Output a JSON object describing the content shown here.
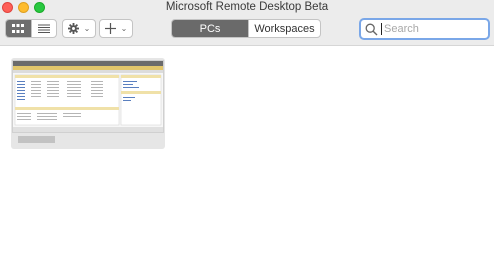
{
  "window": {
    "title": "Microsoft Remote Desktop Beta"
  },
  "toolbar": {
    "view_toggle": {
      "grid_icon": "grid-view-icon",
      "list_icon": "list-view-icon",
      "active": "grid"
    },
    "settings_icon": "gear-icon",
    "add_icon": "plus-icon",
    "tabs": [
      {
        "label": "PCs",
        "selected": true
      },
      {
        "label": "Workspaces",
        "selected": false
      }
    ],
    "search": {
      "placeholder": "Search",
      "value": ""
    }
  },
  "pcs": [
    {
      "name": "",
      "thumbnail": "remote-desktop-preview"
    }
  ],
  "colors": {
    "traffic_red": "#fe5f57",
    "traffic_yellow": "#febc2e",
    "traffic_green": "#28c840",
    "segment_active": "#6a6a6a",
    "search_focus": "#7aa7e8"
  }
}
